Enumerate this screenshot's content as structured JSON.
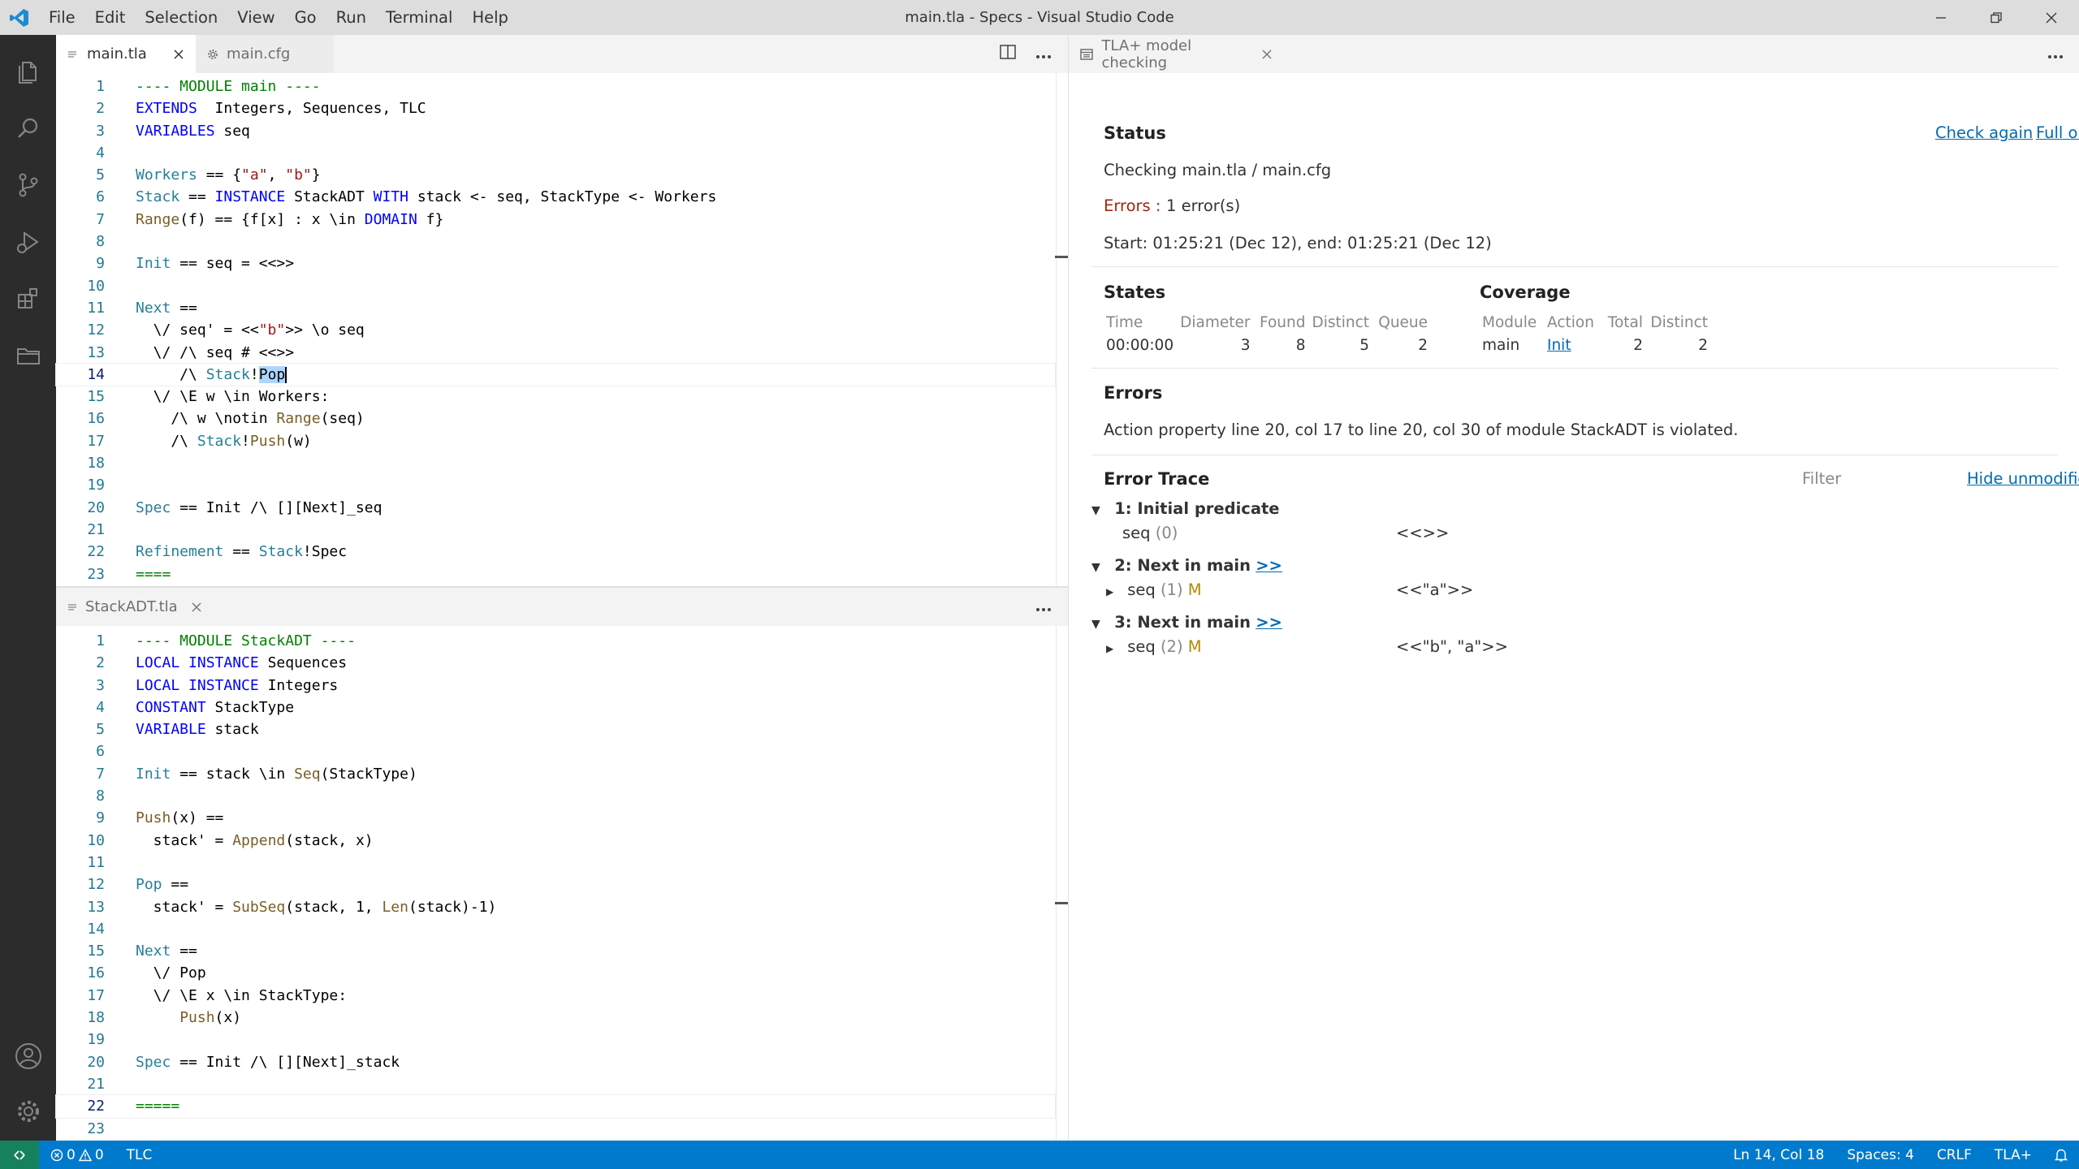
{
  "window": {
    "title": "main.tla - Specs - Visual Studio Code",
    "menu": [
      "File",
      "Edit",
      "Selection",
      "View",
      "Go",
      "Run",
      "Terminal",
      "Help"
    ]
  },
  "activity_bar": {
    "top": [
      "files-icon",
      "search-icon",
      "source-control-icon",
      "run-debug-icon",
      "extensions-icon",
      "folder-icon"
    ],
    "bottom": [
      "account-icon",
      "manage-gear-icon"
    ]
  },
  "editor_top": {
    "tabs": [
      "main.tla",
      "main.cfg"
    ],
    "lines": [
      {
        "n": "1",
        "t": [
          [
            "grn",
            "---- MODULE main ----"
          ]
        ]
      },
      {
        "n": "2",
        "t": [
          [
            "kw",
            "EXTENDS"
          ],
          [
            "",
            "  Integers, Sequences, TLC"
          ]
        ]
      },
      {
        "n": "3",
        "t": [
          [
            "kw",
            "VARIABLES"
          ],
          [
            "",
            " seq"
          ]
        ]
      },
      {
        "n": "4",
        "t": []
      },
      {
        "n": "5",
        "t": [
          [
            "id",
            "Workers"
          ],
          [
            "",
            " == {"
          ],
          [
            "str",
            "\"a\""
          ],
          [
            "",
            ", "
          ],
          [
            "str",
            "\"b\""
          ],
          [
            "",
            "}"
          ]
        ]
      },
      {
        "n": "6",
        "t": [
          [
            "id",
            "Stack"
          ],
          [
            "",
            " == "
          ],
          [
            "kw",
            "INSTANCE"
          ],
          [
            "",
            " StackADT "
          ],
          [
            "kw",
            "WITH"
          ],
          [
            "",
            " stack <- seq, StackType <- Workers"
          ]
        ]
      },
      {
        "n": "7",
        "t": [
          [
            "fn",
            "Range"
          ],
          [
            "",
            "(f) == {f[x] : x \\in "
          ],
          [
            "kw",
            "DOMAIN"
          ],
          [
            "",
            " f}"
          ]
        ]
      },
      {
        "n": "8",
        "t": []
      },
      {
        "n": "9",
        "t": [
          [
            "id",
            "Init"
          ],
          [
            "",
            " == seq = <<>>"
          ]
        ]
      },
      {
        "n": "10",
        "t": []
      },
      {
        "n": "11",
        "t": [
          [
            "id",
            "Next"
          ],
          [
            "",
            " =="
          ]
        ]
      },
      {
        "n": "12",
        "t": [
          [
            "",
            "  \\/ seq' = <<"
          ],
          [
            "str",
            "\"b\""
          ],
          [
            "",
            ">> \\o seq"
          ]
        ]
      },
      {
        "n": "13",
        "t": [
          [
            "",
            "  \\/ /\\ seq # <<>>"
          ]
        ]
      },
      {
        "n": "14",
        "t": [
          [
            "",
            "     /\\ "
          ],
          [
            "id",
            "Stack"
          ],
          [
            "",
            "!"
          ],
          [
            "sel",
            "Pop"
          ]
        ],
        "current": true
      },
      {
        "n": "15",
        "t": [
          [
            "",
            "  \\/ \\E w \\in Workers:"
          ]
        ]
      },
      {
        "n": "16",
        "t": [
          [
            "",
            "    /\\ w \\notin "
          ],
          [
            "fn",
            "Range"
          ],
          [
            "",
            "(seq)"
          ]
        ]
      },
      {
        "n": "17",
        "t": [
          [
            "",
            "    /\\ "
          ],
          [
            "id",
            "Stack"
          ],
          [
            "",
            "!"
          ],
          [
            "fn",
            "Push"
          ],
          [
            "",
            "(w)"
          ]
        ]
      },
      {
        "n": "18",
        "t": []
      },
      {
        "n": "19",
        "t": []
      },
      {
        "n": "20",
        "t": [
          [
            "id",
            "Spec"
          ],
          [
            "",
            " == Init /\\ [][Next]_seq"
          ]
        ]
      },
      {
        "n": "21",
        "t": []
      },
      {
        "n": "22",
        "t": [
          [
            "id",
            "Refinement"
          ],
          [
            "",
            " == "
          ],
          [
            "id",
            "Stack"
          ],
          [
            "",
            "!Spec"
          ]
        ]
      },
      {
        "n": "23",
        "t": [
          [
            "grn",
            "===="
          ]
        ]
      }
    ]
  },
  "editor_bottom": {
    "tabs": [
      "StackADT.tla"
    ],
    "lines": [
      {
        "n": "1",
        "t": [
          [
            "grn",
            "---- MODULE StackADT ----"
          ]
        ]
      },
      {
        "n": "2",
        "t": [
          [
            "kw",
            "LOCAL"
          ],
          [
            "",
            " "
          ],
          [
            "kw",
            "INSTANCE"
          ],
          [
            "",
            " Sequences"
          ]
        ]
      },
      {
        "n": "3",
        "t": [
          [
            "kw",
            "LOCAL"
          ],
          [
            "",
            " "
          ],
          [
            "kw",
            "INSTANCE"
          ],
          [
            "",
            " Integers"
          ]
        ]
      },
      {
        "n": "4",
        "t": [
          [
            "kw",
            "CONSTANT"
          ],
          [
            "",
            " StackType"
          ]
        ]
      },
      {
        "n": "5",
        "t": [
          [
            "kw",
            "VARIABLE"
          ],
          [
            "",
            " stack"
          ]
        ]
      },
      {
        "n": "6",
        "t": []
      },
      {
        "n": "7",
        "t": [
          [
            "id",
            "Init"
          ],
          [
            "",
            " == stack \\in "
          ],
          [
            "fn",
            "Seq"
          ],
          [
            "",
            "(StackType)"
          ]
        ]
      },
      {
        "n": "8",
        "t": []
      },
      {
        "n": "9",
        "t": [
          [
            "fn",
            "Push"
          ],
          [
            "",
            "(x) =="
          ]
        ]
      },
      {
        "n": "10",
        "t": [
          [
            "",
            "  stack' = "
          ],
          [
            "fn",
            "Append"
          ],
          [
            "",
            "(stack, x)"
          ]
        ]
      },
      {
        "n": "11",
        "t": []
      },
      {
        "n": "12",
        "t": [
          [
            "id",
            "Pop"
          ],
          [
            "",
            " =="
          ]
        ]
      },
      {
        "n": "13",
        "t": [
          [
            "",
            "  stack' = "
          ],
          [
            "fn",
            "SubSeq"
          ],
          [
            "",
            "(stack, 1, "
          ],
          [
            "fn",
            "Len"
          ],
          [
            "",
            "(stack)-1)"
          ]
        ]
      },
      {
        "n": "14",
        "t": []
      },
      {
        "n": "15",
        "t": [
          [
            "id",
            "Next"
          ],
          [
            "",
            " =="
          ]
        ]
      },
      {
        "n": "16",
        "t": [
          [
            "",
            "  \\/ Pop"
          ]
        ]
      },
      {
        "n": "17",
        "t": [
          [
            "",
            "  \\/ \\E x \\in StackType:"
          ]
        ]
      },
      {
        "n": "18",
        "t": [
          [
            "",
            "     "
          ],
          [
            "fn",
            "Push"
          ],
          [
            "",
            "(x)"
          ]
        ]
      },
      {
        "n": "19",
        "t": []
      },
      {
        "n": "20",
        "t": [
          [
            "id",
            "Spec"
          ],
          [
            "",
            " == Init /\\ [][Next]_stack"
          ]
        ]
      },
      {
        "n": "21",
        "t": []
      },
      {
        "n": "22",
        "t": [
          [
            "grn",
            "====="
          ]
        ],
        "current": true
      },
      {
        "n": "23",
        "t": []
      }
    ]
  },
  "panel": {
    "tab_title": "TLA+ model checking",
    "status": {
      "heading": "Status",
      "check_again": "Check again",
      "full_output": "Full output",
      "checking": "Checking main.tla / main.cfg",
      "errors_label": "Errors :",
      "errors_value": "1 error(s)",
      "times": "Start: 01:25:21 (Dec 12), end: 01:25:21 (Dec 12)"
    },
    "states": {
      "heading": "States",
      "columns": [
        "Time",
        "Diameter",
        "Found",
        "Distinct",
        "Queue"
      ],
      "row": [
        "00:00:00",
        "3",
        "8",
        "5",
        "2"
      ]
    },
    "coverage": {
      "heading": "Coverage",
      "columns": [
        "Module",
        "Action",
        "Total",
        "Distinct"
      ],
      "row": [
        "main",
        "Init",
        "2",
        "2"
      ]
    },
    "errors": {
      "heading": "Errors",
      "message": "Action property line 20, col 17 to line 20, col 30 of module StackADT is violated."
    },
    "trace": {
      "heading": "Error Trace",
      "filter_placeholder": "Filter",
      "hide_unmodified": "Hide unmodified",
      "steps": [
        {
          "title": "1: Initial predicate",
          "link": "",
          "var": "seq",
          "idx": "(0)",
          "mod": "",
          "value": "<<>>",
          "expandable": false
        },
        {
          "title": "2: Next in main",
          "link": ">>",
          "var": "seq",
          "idx": "(1)",
          "mod": "M",
          "value": "<<\"a\">>",
          "expandable": true
        },
        {
          "title": "3: Next in main",
          "link": ">>",
          "var": "seq",
          "idx": "(2)",
          "mod": "M",
          "value": "<<\"b\", \"a\">>",
          "expandable": true
        }
      ]
    }
  },
  "statusbar": {
    "errors": "0",
    "warnings": "0",
    "tlc": "TLC",
    "position": "Ln 14, Col 18",
    "spaces": "Spaces: 4",
    "eol": "CRLF",
    "language": "TLA+"
  },
  "colors": {
    "statusbar": "#007acc",
    "activitybar": "#2c2c2c",
    "link": "#006ab1",
    "keyword": "#0000ff"
  }
}
